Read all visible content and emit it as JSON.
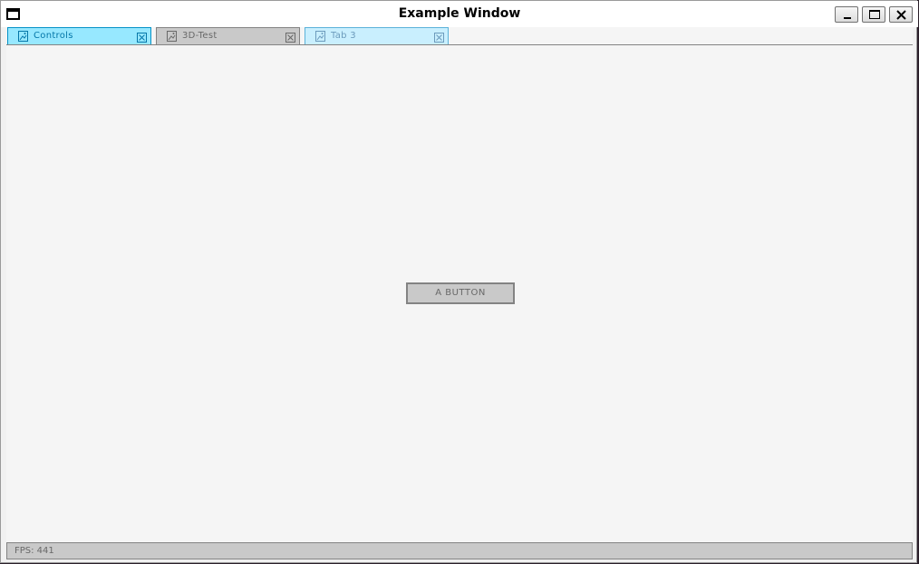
{
  "window": {
    "title": "Example Window"
  },
  "tabs": [
    {
      "label": "Controls",
      "state": "active",
      "icon": "image-icon"
    },
    {
      "label": "3D-Test",
      "state": "normal",
      "icon": "image-icon"
    },
    {
      "label": "Tab 3",
      "state": "hover",
      "icon": "image-icon"
    }
  ],
  "main": {
    "button_label": "A BUTTON"
  },
  "statusbar": {
    "text": "FPS: 441"
  },
  "colors": {
    "active_tab_bg": "#97e8ff",
    "active_tab_border": "#0492c7",
    "normal_control_bg": "#c9c9c9",
    "normal_control_border": "#838383",
    "content_bg": "#f5f5f5"
  }
}
